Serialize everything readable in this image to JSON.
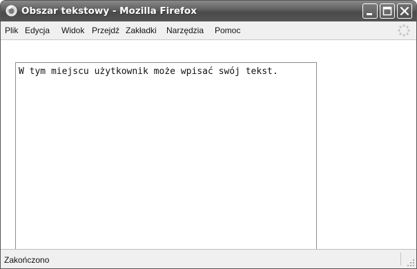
{
  "window": {
    "title": "Obszar tekstowy - Mozilla Firefox",
    "icon": "firefox-logo"
  },
  "window_controls": [
    {
      "name": "minimize",
      "icon": "minimize-icon"
    },
    {
      "name": "maximize",
      "icon": "maximize-icon"
    },
    {
      "name": "close",
      "icon": "close-icon"
    }
  ],
  "menubar": {
    "items": [
      {
        "label": "Plik"
      },
      {
        "label": "Edycja"
      },
      {
        "label": "Widok"
      },
      {
        "label": "Przejdź"
      },
      {
        "label": "Zakładki"
      },
      {
        "label": "Narzędzia"
      },
      {
        "label": "Pomoc"
      }
    ],
    "activity_icon": "throbber-icon"
  },
  "content": {
    "textarea": {
      "value": "W tym miejscu użytkownik może wpisać swój tekst."
    }
  },
  "statusbar": {
    "text": "Zakończono"
  },
  "colors": {
    "titlebar": "#5d5d5d",
    "menubar": "#f0f0f0",
    "statusbar": "#f0f0f0",
    "content": "#ffffff"
  }
}
